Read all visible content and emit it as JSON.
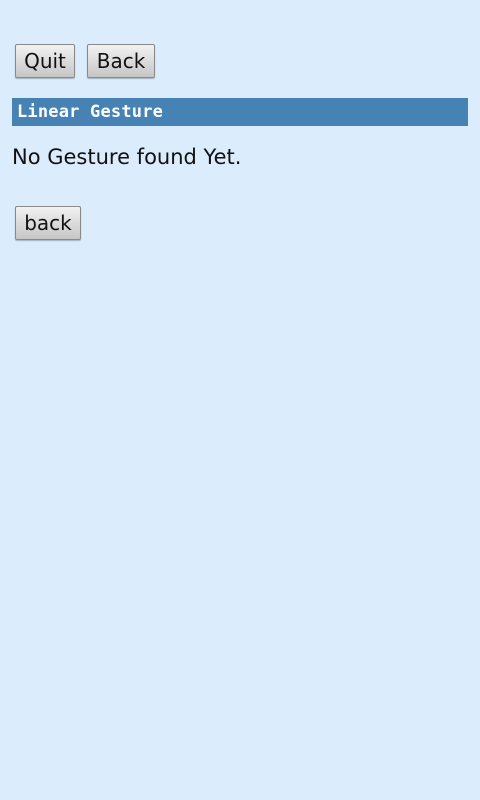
{
  "toolbar": {
    "quit_label": "Quit",
    "back_label": "Back"
  },
  "header": {
    "title": "Linear Gesture"
  },
  "main": {
    "status": "No Gesture found Yet.",
    "back_label": "back"
  },
  "colors": {
    "background": "#dbecfd",
    "header_bar": "#4682b4",
    "header_text": "#ffffff"
  }
}
